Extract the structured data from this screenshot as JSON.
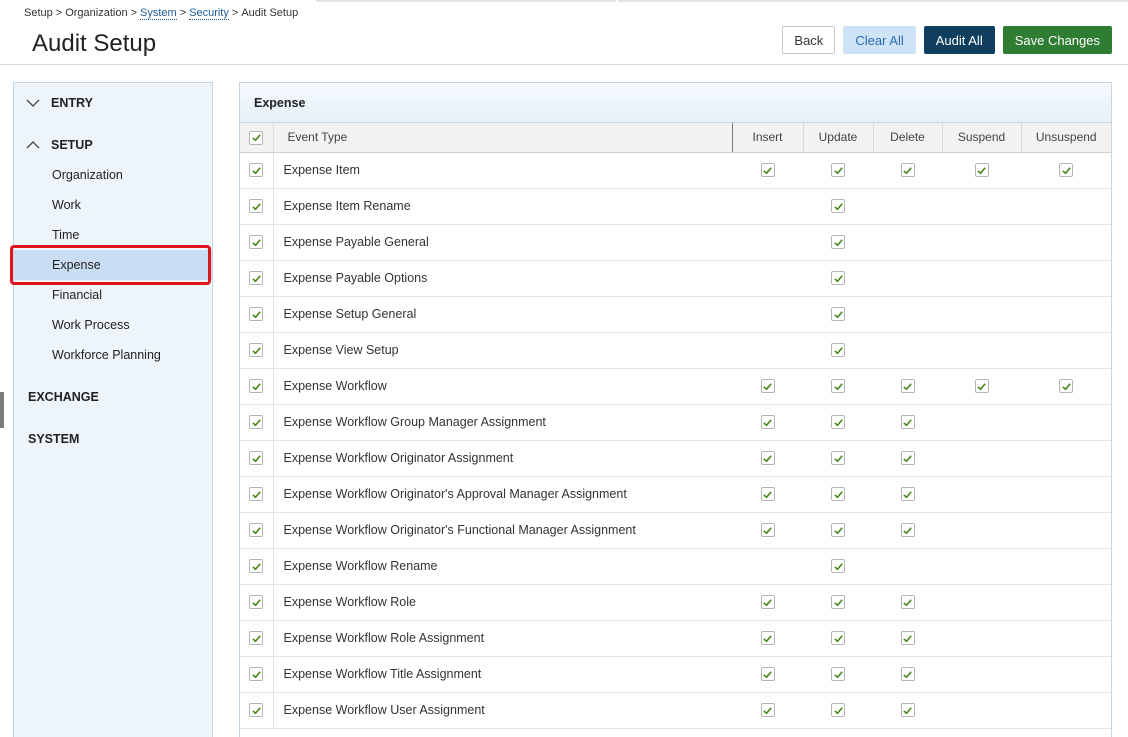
{
  "breadcrumb": {
    "items": [
      "Setup",
      "Organization",
      "System",
      "Security",
      "Audit Setup"
    ],
    "separator": ">"
  },
  "page_title": "Audit Setup",
  "actions": {
    "back": "Back",
    "clear_all": "Clear All",
    "audit_all": "Audit All",
    "save_changes": "Save Changes"
  },
  "sidebar": {
    "groups": [
      {
        "label": "ENTRY",
        "expanded": false
      },
      {
        "label": "SETUP",
        "expanded": true
      },
      {
        "label": "EXCHANGE"
      },
      {
        "label": "SYSTEM"
      }
    ],
    "setup_items": [
      "Organization",
      "Work",
      "Time",
      "Expense",
      "Financial",
      "Work Process",
      "Workforce Planning"
    ],
    "active_item": "Expense"
  },
  "panel": {
    "title": "Expense",
    "columns": [
      "Event Type",
      "Insert",
      "Update",
      "Delete",
      "Suspend",
      "Unsuspend"
    ],
    "rows": [
      {
        "name": "Expense Item",
        "checked": true,
        "flags": [
          true,
          true,
          true,
          true,
          true
        ]
      },
      {
        "name": "Expense Item Rename",
        "checked": true,
        "flags": [
          false,
          true,
          false,
          false,
          false
        ]
      },
      {
        "name": "Expense Payable General",
        "checked": true,
        "flags": [
          false,
          true,
          false,
          false,
          false
        ]
      },
      {
        "name": "Expense Payable Options",
        "checked": true,
        "flags": [
          false,
          true,
          false,
          false,
          false
        ]
      },
      {
        "name": "Expense Setup General",
        "checked": true,
        "flags": [
          false,
          true,
          false,
          false,
          false
        ]
      },
      {
        "name": "Expense View Setup",
        "checked": true,
        "flags": [
          false,
          true,
          false,
          false,
          false
        ]
      },
      {
        "name": "Expense Workflow",
        "checked": true,
        "flags": [
          true,
          true,
          true,
          true,
          true
        ]
      },
      {
        "name": "Expense Workflow Group Manager Assignment",
        "checked": true,
        "flags": [
          true,
          true,
          true,
          false,
          false
        ]
      },
      {
        "name": "Expense Workflow Originator Assignment",
        "checked": true,
        "flags": [
          true,
          true,
          true,
          false,
          false
        ]
      },
      {
        "name": "Expense Workflow Originator's Approval Manager Assignment",
        "checked": true,
        "flags": [
          true,
          true,
          true,
          false,
          false
        ]
      },
      {
        "name": "Expense Workflow Originator's Functional Manager Assignment",
        "checked": true,
        "flags": [
          true,
          true,
          true,
          false,
          false
        ]
      },
      {
        "name": "Expense Workflow Rename",
        "checked": true,
        "flags": [
          false,
          true,
          false,
          false,
          false
        ]
      },
      {
        "name": "Expense Workflow Role",
        "checked": true,
        "flags": [
          true,
          true,
          true,
          false,
          false
        ]
      },
      {
        "name": "Expense Workflow Role Assignment",
        "checked": true,
        "flags": [
          true,
          true,
          true,
          false,
          false
        ]
      },
      {
        "name": "Expense Workflow Title Assignment",
        "checked": true,
        "flags": [
          true,
          true,
          true,
          false,
          false
        ]
      },
      {
        "name": "Expense Workflow User Assignment",
        "checked": true,
        "flags": [
          true,
          true,
          true,
          false,
          false
        ]
      }
    ]
  },
  "colors": {
    "check": "#4a8a1c",
    "save": "#2e7d32",
    "audit": "#0f3e5f",
    "clear_bg": "#cfe3f6",
    "active_bg": "#c9def3",
    "highlight": "#e0141d"
  },
  "icons": {
    "collapsed": "chevron-down-icon",
    "expanded": "chevron-up-icon",
    "checkbox": "checkmark-icon"
  }
}
